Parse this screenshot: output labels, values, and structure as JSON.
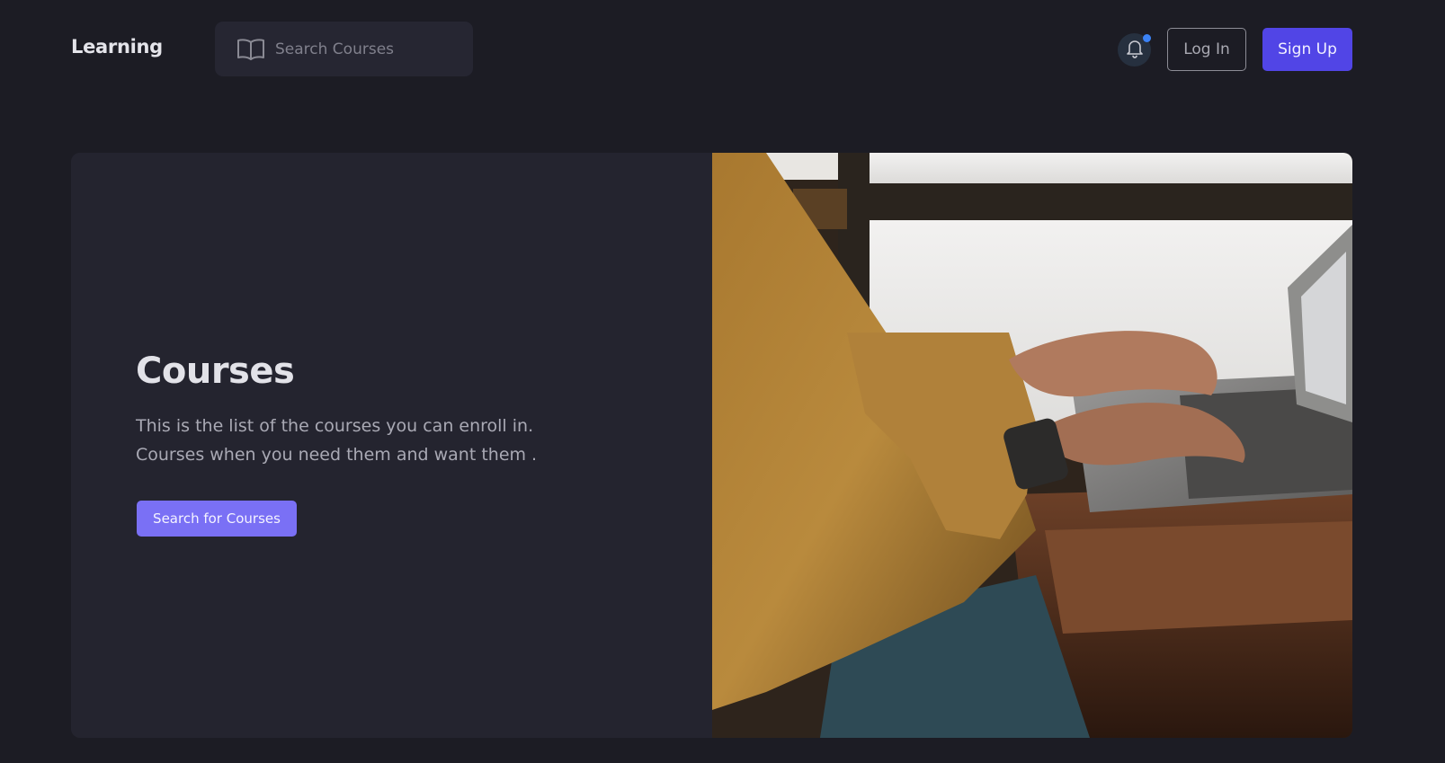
{
  "header": {
    "brand": "Learning",
    "search": {
      "placeholder": "Search Courses",
      "icon": "book-open-icon"
    },
    "notifications": {
      "icon": "bell-icon",
      "has_unread": true,
      "dot_color": "#3b82f6"
    },
    "login_label": "Log In",
    "signup_label": "Sign Up"
  },
  "hero": {
    "title": "Courses",
    "description_lines": [
      "This is the list of the courses you can enroll in.",
      "Courses when you need them and want them ."
    ],
    "cta_label": "Search for Courses",
    "image": "photo-person-typing-on-laptop"
  },
  "colors": {
    "background": "#1c1c24",
    "panel": "#24242f",
    "primary": "#5145e6",
    "cta": "#7a70f5"
  }
}
